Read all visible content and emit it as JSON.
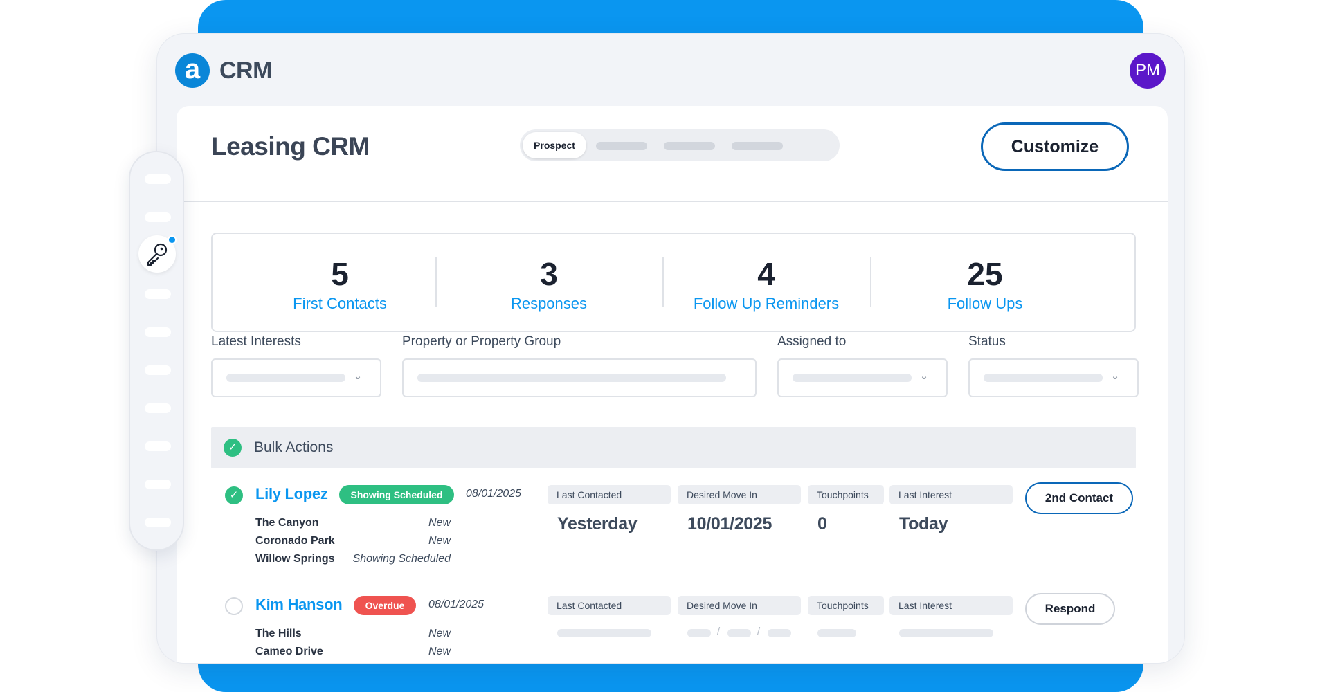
{
  "app": {
    "logo_glyph": "a",
    "title": "CRM",
    "avatar_initials": "PM"
  },
  "page": {
    "title": "Leasing CRM",
    "tabs": [
      {
        "label": "Prospect",
        "active": true
      }
    ],
    "customize_label": "Customize"
  },
  "stats": [
    {
      "value": "5",
      "label": "First Contacts"
    },
    {
      "value": "3",
      "label": "Responses"
    },
    {
      "value": "4",
      "label": "Follow Up Reminders"
    },
    {
      "value": "25",
      "label": "Follow Ups"
    }
  ],
  "filters": [
    {
      "label": "Latest Interests"
    },
    {
      "label": "Property or Property Group"
    },
    {
      "label": "Assigned to"
    },
    {
      "label": "Status"
    }
  ],
  "bulk_actions": {
    "label": "Bulk Actions",
    "checked": true
  },
  "leads": [
    {
      "name": "Lily Lopez",
      "checked": true,
      "badge": "Showing Scheduled",
      "date": "08/01/2025",
      "properties": [
        {
          "name": "The Canyon",
          "status": "New"
        },
        {
          "name": "Coronado Park",
          "status": "New"
        },
        {
          "name": "Willow Springs",
          "status": "Showing Scheduled"
        }
      ],
      "columns": [
        {
          "label": "Last Contacted",
          "value": "Yesterday"
        },
        {
          "label": "Desired Move In",
          "value": "10/01/2025"
        },
        {
          "label": "Touchpoints",
          "value": "0"
        },
        {
          "label": "Last Interest",
          "value": "Today"
        }
      ],
      "action": "2nd Contact"
    },
    {
      "name": "Kim Hanson",
      "checked": false,
      "badge": "Overdue",
      "date": "08/01/2025",
      "properties": [
        {
          "name": "The Hills",
          "status": "New"
        },
        {
          "name": "Cameo Drive",
          "status": "New"
        }
      ],
      "columns": [
        {
          "label": "Last Contacted"
        },
        {
          "label": "Desired Move In"
        },
        {
          "label": "Touchpoints"
        },
        {
          "label": "Last Interest"
        }
      ],
      "action": "Respond"
    }
  ],
  "colors": {
    "accent": "#0a96f0",
    "brand_dark": "#0a67b8",
    "success": "#2ebf82",
    "danger": "#ef5350",
    "avatar": "#5b17c9"
  },
  "icons": {
    "check": "check-icon",
    "chevron": "chevron-down-icon",
    "nav_active": "key-icon"
  }
}
